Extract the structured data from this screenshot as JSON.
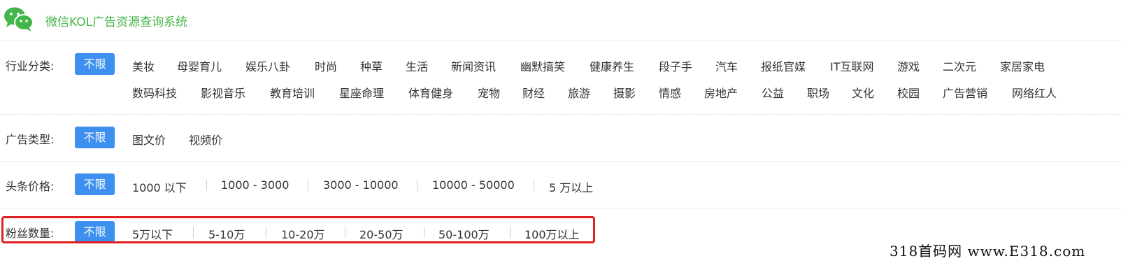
{
  "header": {
    "title": "微信KOL广告资源查询系统",
    "logo_icon": "wechat-logo-icon",
    "brand_color": "#44b549"
  },
  "filters": {
    "all_label": "不限",
    "industry": {
      "label": "行业分类:",
      "options": [
        "美妆",
        "母婴育儿",
        "娱乐八卦",
        "时尚",
        "种草",
        "生活",
        "新闻资讯",
        "幽默搞笑",
        "健康养生",
        "段子手",
        "汽车",
        "报纸官媒",
        "IT互联网",
        "游戏",
        "二次元",
        "家居家电",
        "数码科技",
        "影视音乐",
        "教育培训",
        "星座命理",
        "体育健身",
        "宠物",
        "财经",
        "旅游",
        "摄影",
        "情感",
        "房地产",
        "公益",
        "职场",
        "文化",
        "校园",
        "广告营销",
        "网络红人"
      ]
    },
    "ad_type": {
      "label": "广告类型:",
      "options": [
        "图文价",
        "视频价"
      ]
    },
    "headline_price": {
      "label": "头条价格:",
      "options": [
        "1000 以下",
        "1000 - 3000",
        "3000 - 10000",
        "10000 - 50000",
        "5 万以上"
      ]
    },
    "fans": {
      "label": "粉丝数量:",
      "options": [
        "5万以下",
        "5-10万",
        "10-20万",
        "20-50万",
        "50-100万",
        "100万以上"
      ]
    }
  },
  "watermark": "318首码网 www.E318.com",
  "colors": {
    "active_button": "#3d8ff0",
    "highlight_border": "#e02020"
  }
}
